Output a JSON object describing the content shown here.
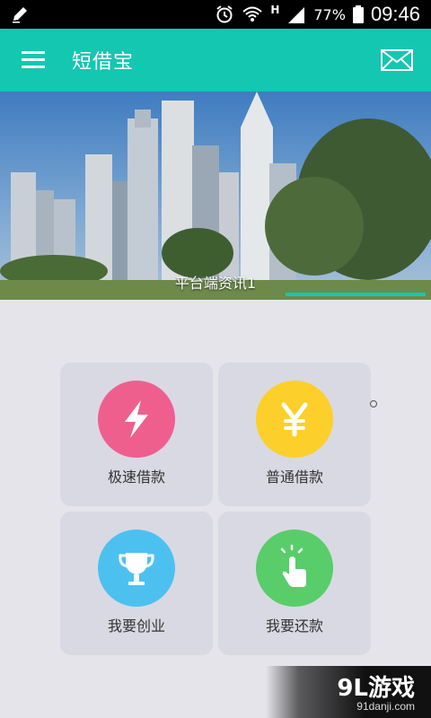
{
  "status_bar": {
    "battery": "77%",
    "time": "09:46",
    "network": "H"
  },
  "app_bar": {
    "title": "短借宝"
  },
  "banner": {
    "caption": "平台端资讯1"
  },
  "tiles": [
    {
      "label": "极速借款",
      "icon": "lightning-icon",
      "color": "#ef5f8d"
    },
    {
      "label": "普通借款",
      "icon": "yen-icon",
      "color": "#fdcf2a"
    },
    {
      "label": "我要创业",
      "icon": "trophy-icon",
      "color": "#4cc1f0"
    },
    {
      "label": "我要还款",
      "icon": "tap-hand-icon",
      "color": "#58cd6a"
    }
  ],
  "watermark": {
    "logo": "9L游戏",
    "url": "91danji.com"
  }
}
